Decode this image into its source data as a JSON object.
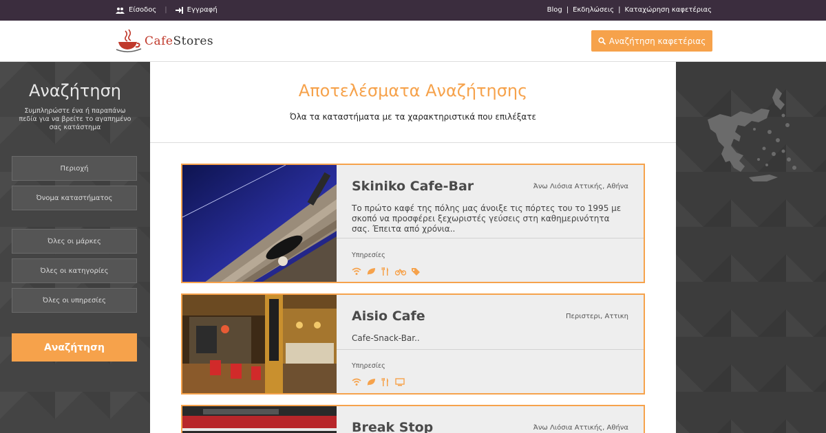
{
  "topbar": {
    "login": "Είσοδος",
    "register": "Εγγραφή",
    "links": [
      "Blog",
      "Εκδηλώσεις",
      "Καταχώρηση καφετέριας"
    ]
  },
  "header": {
    "logo_text_cafe": "Cafe",
    "logo_text_stores": "Stores",
    "search_button": "Αναζήτηση καφετέριας"
  },
  "sidebar": {
    "title": "Αναζήτηση",
    "description": "Συμπληρώστε ένα ή παραπάνω πεδία για να βρείτε το αγαπημένο σας κατάστημα",
    "fields": [
      "Περιοχή",
      "Όνομα καταστήματος",
      "Όλες οι μάρκες",
      "Όλες οι κατηγορίες",
      "Όλες οι υπηρεσίες"
    ],
    "submit": "Αναζήτηση"
  },
  "main": {
    "title": "Αποτελέσματα Αναζήτησης",
    "subtitle": "Όλα τα καταστήματα με τα χαρακτηριστικά που επιλέξατε",
    "results": [
      {
        "name": "Skiniko Cafe-Bar",
        "location": "Άνω Λιόσια Αττικής, Αθήνα",
        "description": "Το πρώτο καφέ της πόλης μας άνοιξε τις πόρτες του το 1995 με σκοπό να προσφέρει ξεχωριστές γεύσεις στη καθημερινότητα σας. Έπειτα από χρόνια..",
        "services_label": "Υπηρεσίες",
        "services": [
          "wifi-icon",
          "leaf-icon",
          "cutlery-icon",
          "bicycle-icon",
          "tag-icon"
        ]
      },
      {
        "name": "Aisio Cafe",
        "location": "Περιστερι, Αττικη",
        "description": "Cafe-Snack-Bar..",
        "services_label": "Υπηρεσίες",
        "services": [
          "wifi-icon",
          "leaf-icon",
          "cutlery-icon",
          "tv-icon"
        ]
      },
      {
        "name": "Break Stop",
        "location": "Άνω Λιόσια Αττικής, Αθήνα"
      }
    ]
  },
  "colors": {
    "accent": "#f6a24b",
    "topbar": "#3b2d3e",
    "sidebar": "#444444"
  }
}
